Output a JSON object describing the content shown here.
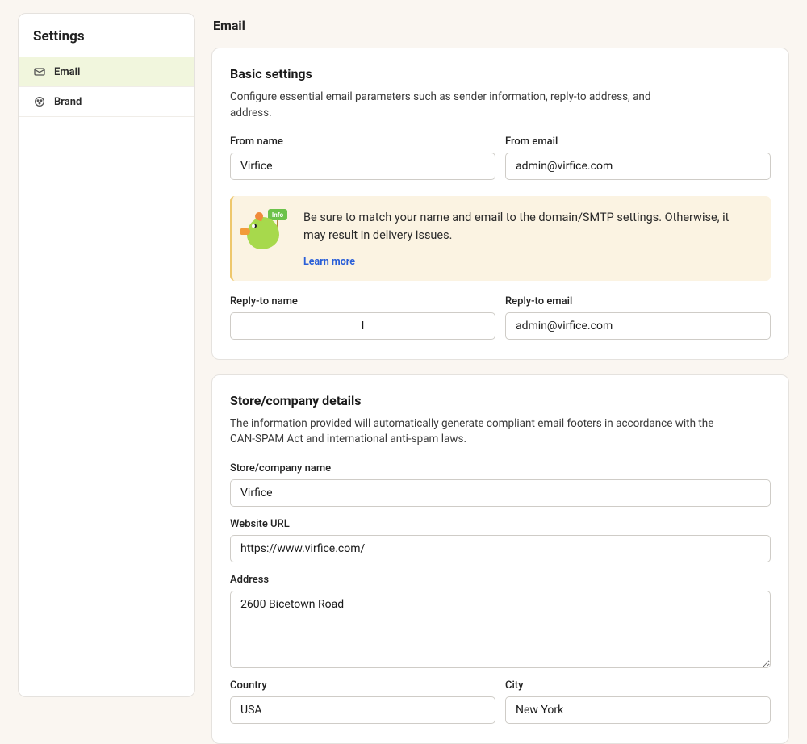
{
  "sidebar": {
    "title": "Settings",
    "items": [
      {
        "label": "Email",
        "icon": "email-icon",
        "active": true
      },
      {
        "label": "Brand",
        "icon": "brand-icon",
        "active": false
      }
    ]
  },
  "page": {
    "title": "Email"
  },
  "basic": {
    "title": "Basic settings",
    "desc": "Configure essential email parameters such as sender information, reply-to address, and address.",
    "from_name": {
      "label": "From name",
      "value": "Virfice"
    },
    "from_email": {
      "label": "From email",
      "value": "admin@virfice.com"
    },
    "banner": {
      "text": "Be sure to match your name and email to the domain/SMTP settings. Otherwise, it may result in delivery issues.",
      "learn_more": "Learn more",
      "sign": "Info"
    },
    "reply_name": {
      "label": "Reply-to name",
      "value": "I"
    },
    "reply_email": {
      "label": "Reply-to email",
      "value": "admin@virfice.com"
    }
  },
  "store": {
    "title": "Store/company details",
    "desc": "The information provided will automatically generate compliant email footers in accordance with the CAN-SPAM Act and international anti-spam laws.",
    "company": {
      "label": "Store/company name",
      "value": "Virfice"
    },
    "url": {
      "label": "Website URL",
      "value": "https://www.virfice.com/"
    },
    "address": {
      "label": "Address",
      "value": "2600 Bicetown Road"
    },
    "country": {
      "label": "Country",
      "value": "USA"
    },
    "city": {
      "label": "City",
      "value": "New York"
    }
  }
}
